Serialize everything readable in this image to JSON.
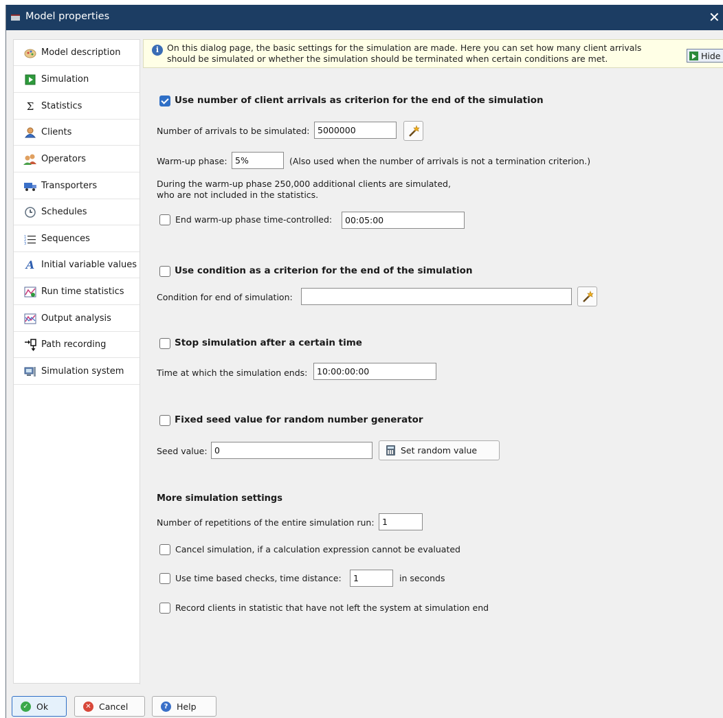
{
  "window": {
    "title": "Model properties",
    "close_glyph": "✕"
  },
  "sidebar": {
    "items": [
      {
        "label": "Model description",
        "icon": "model-description-icon"
      },
      {
        "label": "Simulation",
        "icon": "simulation-icon",
        "active": true
      },
      {
        "label": "Statistics",
        "icon": "sigma-icon"
      },
      {
        "label": "Clients",
        "icon": "clients-icon"
      },
      {
        "label": "Operators",
        "icon": "operators-icon"
      },
      {
        "label": "Transporters",
        "icon": "transporters-icon"
      },
      {
        "label": "Schedules",
        "icon": "schedules-icon"
      },
      {
        "label": "Sequences",
        "icon": "sequences-icon"
      },
      {
        "label": "Initial variable values",
        "icon": "variable-icon"
      },
      {
        "label": "Run time statistics",
        "icon": "runtime-chart-icon"
      },
      {
        "label": "Output analysis",
        "icon": "output-chart-icon"
      },
      {
        "label": "Path recording",
        "icon": "path-recording-icon"
      },
      {
        "label": "Simulation system",
        "icon": "simulation-system-icon"
      }
    ]
  },
  "info": {
    "text_line1": "On this dialog page, the basic settings for the simulation are made. Here you can set how many client arrivals",
    "text_line2": "should be simulated or whether the simulation should be terminated when certain conditions are met.",
    "hide_label": "Hide"
  },
  "arrivals": {
    "checkbox_label": "Use number of client arrivals as criterion for the end of the simulation",
    "checked": true,
    "count_label": "Number of arrivals to be simulated:",
    "count_value": "5000000",
    "warmup_label": "Warm-up phase:",
    "warmup_value": "5%",
    "warmup_note": "(Also used when the number of arrivals is not a termination criterion.)",
    "warmup_info_line1": "During the warm-up phase 250,000 additional clients are simulated,",
    "warmup_info_line2": "who are not included in the statistics.",
    "end_warmup_label": "End warm-up phase time-controlled:",
    "end_warmup_checked": false,
    "end_warmup_value": "00:05:00"
  },
  "condition": {
    "checkbox_label": "Use condition as a criterion for the end of the simulation",
    "checked": false,
    "field_label": "Condition for end of simulation:",
    "field_value": ""
  },
  "time_stop": {
    "checkbox_label": "Stop simulation after a certain time",
    "checked": false,
    "field_label": "Time at which the simulation ends:",
    "field_value": "10:00:00:00"
  },
  "seed": {
    "checkbox_label": "Fixed seed value for random number generator",
    "checked": false,
    "field_label": "Seed value:",
    "field_value": "0",
    "random_button": "Set random value"
  },
  "more": {
    "heading": "More simulation settings",
    "repetitions_label": "Number of repetitions of the entire simulation run:",
    "repetitions_value": "1",
    "cancel_label": "Cancel simulation, if a calculation expression cannot be evaluated",
    "timechecks_label": "Use time based checks, time distance:",
    "timechecks_value": "1",
    "timechecks_unit": "in seconds",
    "record_label": "Record clients in statistic that have not left the system at simulation end"
  },
  "footer": {
    "ok": "Ok",
    "cancel": "Cancel",
    "help": "Help"
  },
  "colors": {
    "titlebar": "#1c3d63",
    "accent": "#2f6fc6",
    "info_bg": "#ffffe6"
  }
}
